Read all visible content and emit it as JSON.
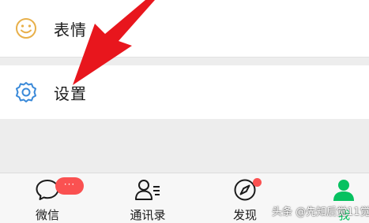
{
  "menu": {
    "sticker": {
      "label": "表情",
      "icon": "smiley-icon"
    },
    "settings": {
      "label": "设置",
      "icon": "gear-icon"
    }
  },
  "tabbar": {
    "tabs": [
      {
        "label": "微信",
        "icon": "chat-bubble-icon",
        "badge": "···"
      },
      {
        "label": "通讯录",
        "icon": "contacts-icon"
      },
      {
        "label": "发现",
        "icon": "compass-icon",
        "dot": true
      },
      {
        "label": "我",
        "icon": "person-icon",
        "active": true
      }
    ]
  },
  "watermark": "头条 @先知后觉11觉",
  "colors": {
    "accent": "#07c160",
    "badge": "#fa5151",
    "sticker_icon": "#e8b04a",
    "settings_icon": "#3b8ad9",
    "annotation_arrow": "#e8161d"
  }
}
